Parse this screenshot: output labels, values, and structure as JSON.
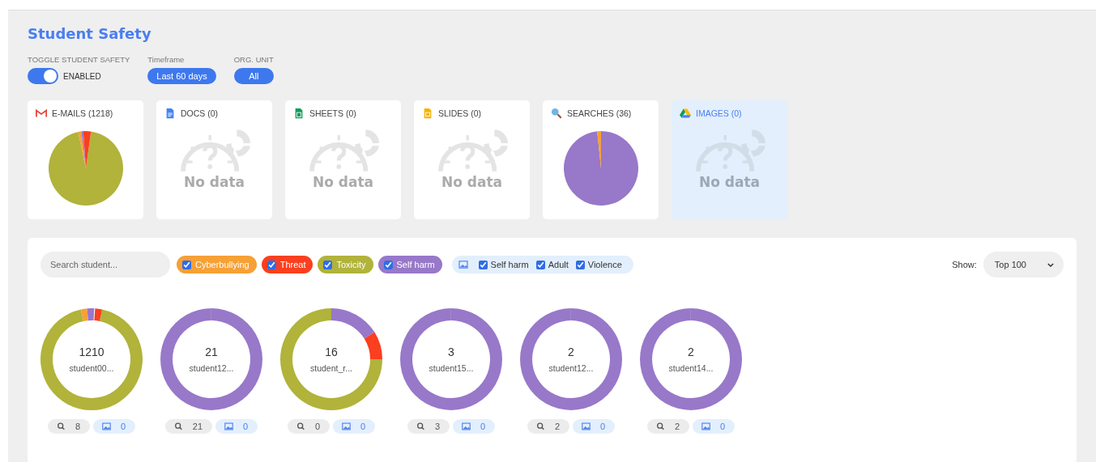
{
  "title": "Student Safety",
  "controls": [
    {
      "label": "TOGGLE STUDENT SAFETY",
      "kind": "toggle",
      "on": true,
      "value": "ENABLED"
    },
    {
      "label": "Timeframe",
      "kind": "pill",
      "value": "Last 60 days"
    },
    {
      "label": "ORG. UNIT",
      "kind": "pill",
      "value": "All"
    }
  ],
  "cards": [
    {
      "label": "E-MAILS (1218)",
      "kind": "pie",
      "selected": false
    },
    {
      "label": "DOCS (0)",
      "kind": "no_data",
      "placeholder": "No data",
      "selected": false
    },
    {
      "label": "SHEETS (0)",
      "kind": "no_data",
      "placeholder": "No data",
      "selected": false
    },
    {
      "label": "SLIDES (0)",
      "kind": "no_data",
      "placeholder": "No data",
      "selected": false
    },
    {
      "label": "SEARCHES (36)",
      "kind": "pie",
      "selected": false
    },
    {
      "label": "IMAGES (0)",
      "kind": "no_data",
      "placeholder": "No data",
      "selected": true
    }
  ],
  "search": {
    "placeholder": "Search student..."
  },
  "categories": [
    {
      "label": "Cyberbullying",
      "color": "#f7a035",
      "checked": true
    },
    {
      "label": "Threat",
      "color": "#fb3f1f",
      "checked": true
    },
    {
      "label": "Toxicity",
      "color": "#b1b33a",
      "checked": true
    },
    {
      "label": "Self harm",
      "color": "#9878c9",
      "checked": true
    }
  ],
  "image_filters": [
    {
      "label": "Self harm",
      "checked": true
    },
    {
      "label": "Adult",
      "checked": true
    },
    {
      "label": "Violence",
      "checked": true
    }
  ],
  "show": {
    "label": "Show:",
    "value": "Top 100"
  },
  "students": [
    {
      "count": "1210",
      "name": "student00...",
      "searches": "8",
      "images": "0"
    },
    {
      "count": "21",
      "name": "student12...",
      "searches": "21",
      "images": "0"
    },
    {
      "count": "16",
      "name": "student_r...",
      "searches": "0",
      "images": "0"
    },
    {
      "count": "3",
      "name": "student15...",
      "searches": "3",
      "images": "0"
    },
    {
      "count": "2",
      "name": "student12...",
      "searches": "2",
      "images": "0"
    },
    {
      "count": "2",
      "name": "student14...",
      "searches": "2",
      "images": "0"
    }
  ]
}
